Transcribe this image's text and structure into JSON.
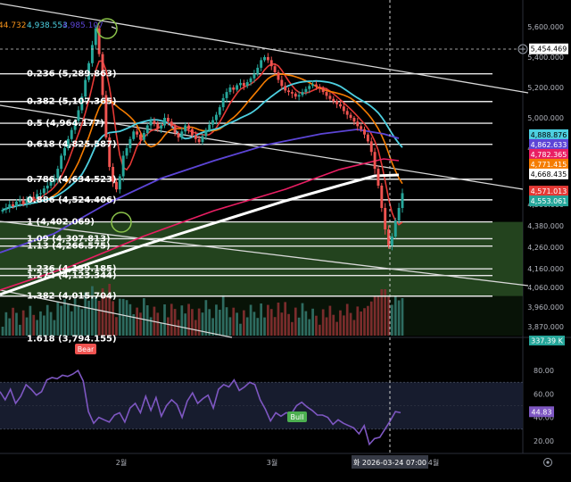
{
  "header": {
    "vals": [
      "44.732",
      "4,938.553",
      "4,985.107"
    ],
    "colors": [
      "#f7931a",
      "#4dd0e1",
      "#5c45d6"
    ]
  },
  "colors": {
    "bg": "#000000",
    "candle_up": "#26a69a",
    "candle_down": "#ef5350",
    "vol_up": "#2e6b60",
    "vol_down": "#7a2c2c",
    "rsi": "#7e57c2",
    "rsi_band": "#1a1f33",
    "green_zone": "#2f5a28",
    "fib": "#e6e6e6",
    "trend": "#d8d8d8"
  },
  "fib_levels": [
    {
      "label": "0.236 (5,289.863)",
      "price": 5289.863
    },
    {
      "label": "0.382 (5,107.365)",
      "price": 5107.365
    },
    {
      "label": "0.5 (4,964.177)",
      "price": 4964.177
    },
    {
      "label": "0.618 (4,825.587)",
      "price": 4825.587
    },
    {
      "label": "0.786 (4,634.523)",
      "price": 4634.523
    },
    {
      "label": "0.886 (4,524.406)",
      "price": 4524.406
    },
    {
      "label": "1 (4,402.069)",
      "price": 4402.069
    },
    {
      "label": "1.09 (4,307.813)",
      "price": 4307.813
    },
    {
      "label": "1.13 (4,266.575)",
      "price": 4266.575
    },
    {
      "label": "1.236 (4,159.185)",
      "price": 4159.185
    },
    {
      "label": "1.272 (4,123.344)",
      "price": 4123.344
    },
    {
      "label": "1.382 (4,015.704)",
      "price": 4015.704
    },
    {
      "label": "1.618 (3,794.155)",
      "price": 3794.155
    }
  ],
  "price_badges": [
    {
      "text": "5,454.469",
      "price": 5454.469,
      "bg": "#ffffff",
      "fg": "#000000"
    },
    {
      "text": "4,888.876",
      "price": 4888.876,
      "bg": "#4dd0e1",
      "fg": "#000000"
    },
    {
      "text": "4,862.633",
      "price": 4862.633,
      "bg": "#5c45d6",
      "fg": "#ffffff"
    },
    {
      "text": "4,782.365",
      "price": 4782.365,
      "bg": "#e91e63",
      "fg": "#ffffff"
    },
    {
      "text": "4,771.415",
      "price": 4771.415,
      "bg": "#f57c00",
      "fg": "#ffffff"
    },
    {
      "text": "4,668.435",
      "price": 4668.435,
      "bg": "#ffffff",
      "fg": "#000000"
    },
    {
      "text": "4,571.013",
      "price": 4571.013,
      "bg": "#e53935",
      "fg": "#ffffff"
    },
    {
      "text": "4,553.061",
      "price": 4553.061,
      "bg": "#26a69a",
      "fg": "#ffffff"
    }
  ],
  "volume_badge": "337.39 K",
  "rsi_badge": "44.83",
  "signals": {
    "bear": "Bear",
    "bull": "Bull"
  },
  "crosshair_label": "화 2026-03-24   07:00",
  "chart_data": {
    "type": "candlestick",
    "price_axis": {
      "ticks": [
        "5,600.000",
        "5,400.000",
        "5,200.000",
        "5,000.000",
        "4,800.000",
        "4,500.000",
        "4,380.000",
        "4,260.000",
        "4,160.000",
        "4,060.000",
        "3,960.000",
        "3,870.000"
      ],
      "range": [
        3800,
        5700
      ]
    },
    "rsi_axis": {
      "ticks": [
        "80.00",
        "60.00",
        "40.00",
        "20.00"
      ],
      "range": [
        10,
        90
      ],
      "band": [
        30,
        70
      ],
      "last": 44.83
    },
    "time_axis": {
      "ticks": [
        "2월",
        "3월",
        "4월"
      ]
    },
    "candles_close": [
      4470,
      4480,
      4500,
      4490,
      4515,
      4520,
      4505,
      4525,
      4540,
      4530,
      4555,
      4560,
      4585,
      4600,
      4620,
      4640,
      4690,
      4760,
      4800,
      4860,
      4920,
      4980,
      5050,
      5140,
      5250,
      5360,
      5480,
      5590,
      5420,
      5150,
      4870,
      4700,
      4620,
      4580,
      4650,
      4760,
      4800,
      4860,
      4910,
      4890,
      4855,
      4900,
      4950,
      4980,
      4960,
      4930,
      4950,
      5000,
      4975,
      4945,
      4900,
      4870,
      4910,
      4950,
      4925,
      4885,
      4860,
      4840,
      4880,
      4920,
      4955,
      4985,
      5020,
      5070,
      5130,
      5170,
      5200,
      5185,
      5215,
      5230,
      5210,
      5235,
      5260,
      5290,
      5330,
      5380,
      5400,
      5380,
      5340,
      5300,
      5250,
      5210,
      5180,
      5170,
      5160,
      5140,
      5150,
      5170,
      5190,
      5210,
      5220,
      5205,
      5195,
      5170,
      5145,
      5125,
      5110,
      5090,
      5075,
      5045,
      5020,
      5000,
      4975,
      4945,
      4925,
      4890,
      4845,
      4780,
      4690,
      4600,
      4480,
      4360,
      4270,
      4320,
      4410,
      4480,
      4560
    ],
    "rsi_values": [
      62,
      55,
      64,
      52,
      58,
      68,
      64,
      59,
      62,
      72,
      74,
      73,
      76,
      75,
      77,
      80,
      71,
      45,
      35,
      40,
      38,
      36,
      42,
      44,
      36,
      48,
      52,
      44,
      58,
      46,
      57,
      41,
      50,
      55,
      51,
      40,
      54,
      61,
      52,
      56,
      59,
      48,
      64,
      68,
      66,
      72,
      63,
      66,
      70,
      68,
      55,
      47,
      37,
      44,
      41,
      44,
      43,
      50,
      53,
      49,
      46,
      42,
      42,
      40,
      34,
      38,
      35,
      33,
      31,
      26,
      33,
      17,
      22,
      23,
      30,
      37,
      45,
      44
    ]
  }
}
